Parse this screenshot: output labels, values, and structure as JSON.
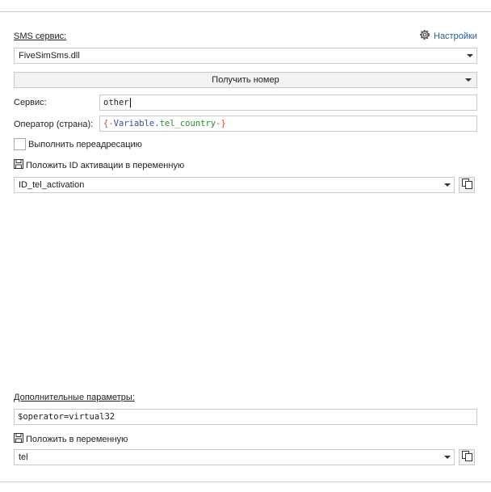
{
  "sms_service": {
    "label": "SMS сервис:",
    "selected": "FiveSimSms.dll",
    "settings_label": "Настройки"
  },
  "action": {
    "label": "Получить номер"
  },
  "service": {
    "label": "Сервис:",
    "value": "other"
  },
  "operator": {
    "label": "Оператор (страна):",
    "open_brace": "{",
    "dash1": "-",
    "var_name": "Variable",
    "dot": ".",
    "var_field": "tel_country",
    "dash2": "-",
    "close_brace": "}"
  },
  "redirect": {
    "label": "Выполнить переадресацию",
    "checked": false
  },
  "activation_var": {
    "label": "Положить ID активации в переменную",
    "selected": "ID_tel_activation"
  },
  "extra_params": {
    "label": "Дополнительные параметры:",
    "value": "$operator=virtual32"
  },
  "result_var": {
    "label": "Положить в переменную",
    "selected": "tel"
  },
  "icons": {
    "settings": "gear-icon",
    "dropdown": "chevron-down-icon",
    "save": "floppy-disk-icon",
    "copy": "copy-icon"
  }
}
